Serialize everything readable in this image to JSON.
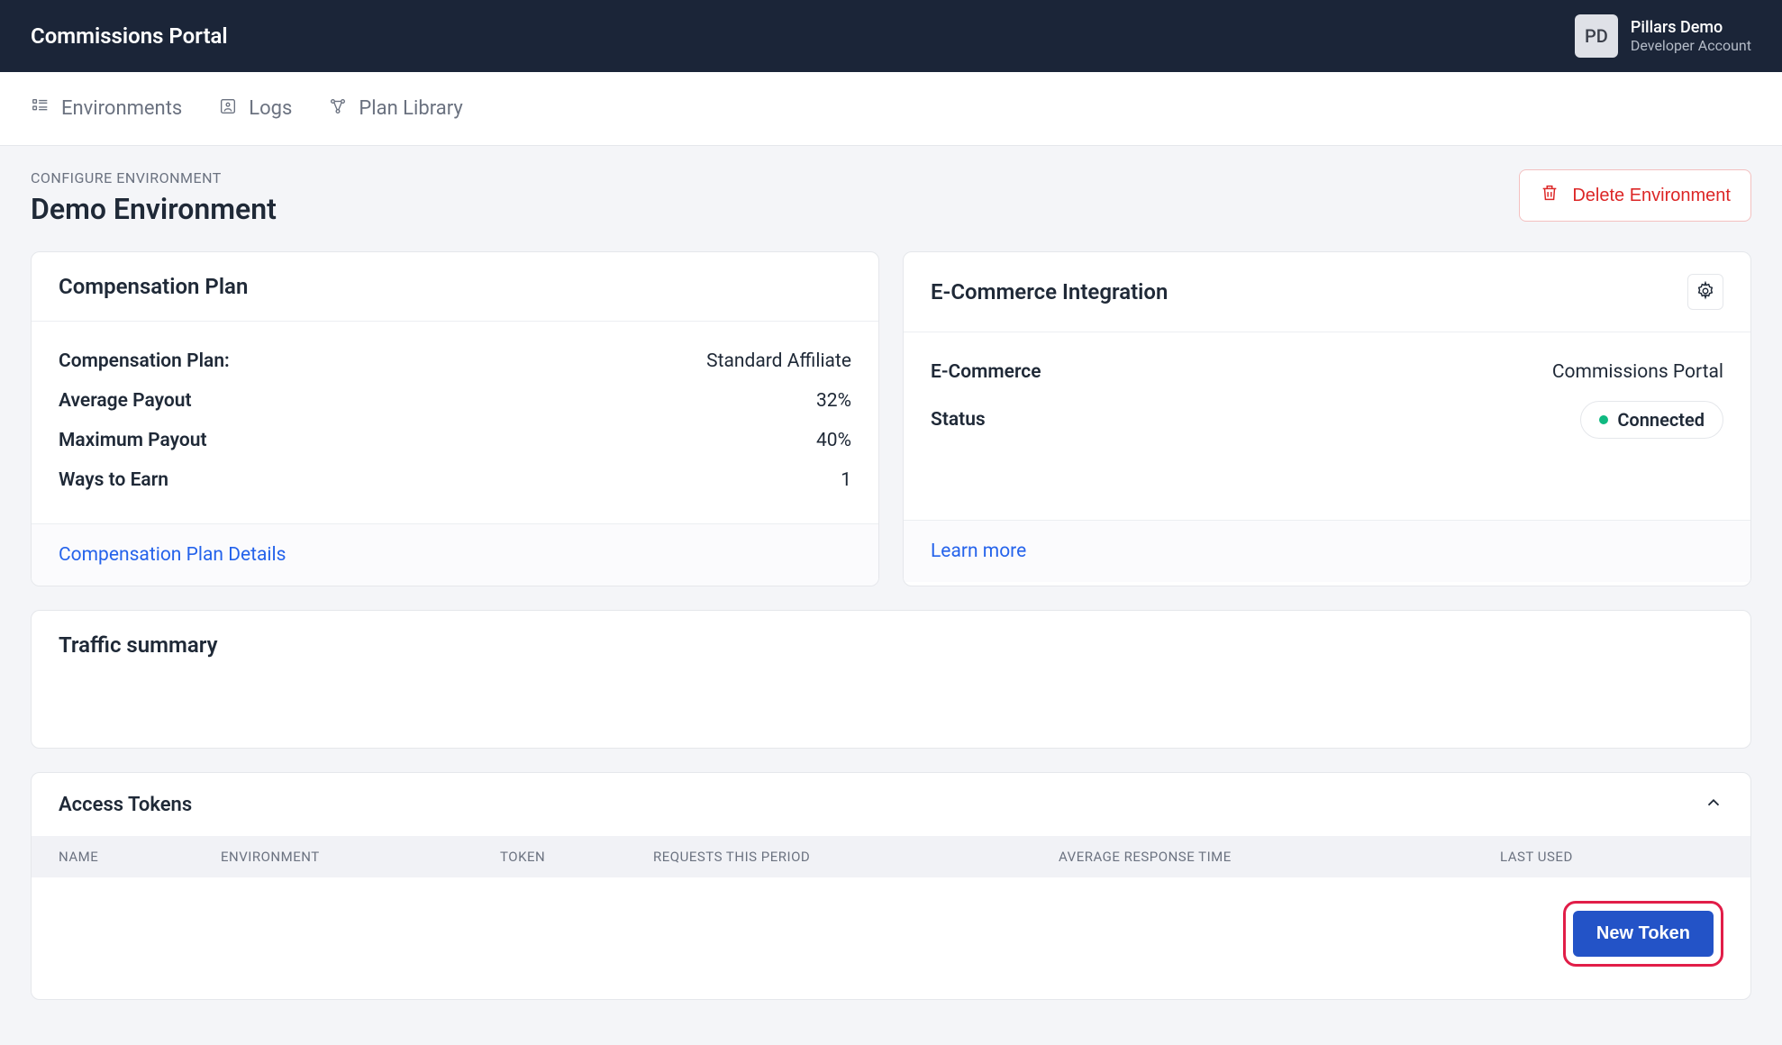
{
  "header": {
    "appTitle": "Commissions Portal",
    "avatarInitials": "PD",
    "userName": "Pillars Demo",
    "userSubtitle": "Developer Account"
  },
  "nav": {
    "environments": "Environments",
    "logs": "Logs",
    "planLibrary": "Plan Library"
  },
  "page": {
    "breadcrumb": "CONFIGURE ENVIRONMENT",
    "title": "Demo Environment",
    "deleteBtn": "Delete Environment"
  },
  "compCard": {
    "title": "Compensation Plan",
    "rows": {
      "planKey": "Compensation Plan:",
      "planVal": "Standard Affiliate",
      "avgKey": "Average Payout",
      "avgVal": "32%",
      "maxKey": "Maximum Payout",
      "maxVal": "40%",
      "waysKey": "Ways to Earn",
      "waysVal": "1"
    },
    "footerLink": "Compensation Plan Details"
  },
  "ecomCard": {
    "title": "E-Commerce Integration",
    "rows": {
      "ecomKey": "E-Commerce",
      "ecomVal": "Commissions Portal",
      "statusKey": "Status",
      "statusVal": "Connected"
    },
    "footerLink": "Learn more"
  },
  "traffic": {
    "title": "Traffic summary"
  },
  "tokens": {
    "title": "Access Tokens",
    "columns": {
      "name": "NAME",
      "env": "ENVIRONMENT",
      "token": "TOKEN",
      "requests": "REQUESTS THIS PERIOD",
      "avgResp": "AVERAGE RESPONSE TIME",
      "lastUsed": "LAST USED"
    },
    "newTokenBtn": "New Token"
  },
  "colors": {
    "headerBg": "#1b2538",
    "accent": "#2353c7",
    "danger": "#dc2626",
    "highlight": "#e11d48",
    "success": "#10b981"
  }
}
